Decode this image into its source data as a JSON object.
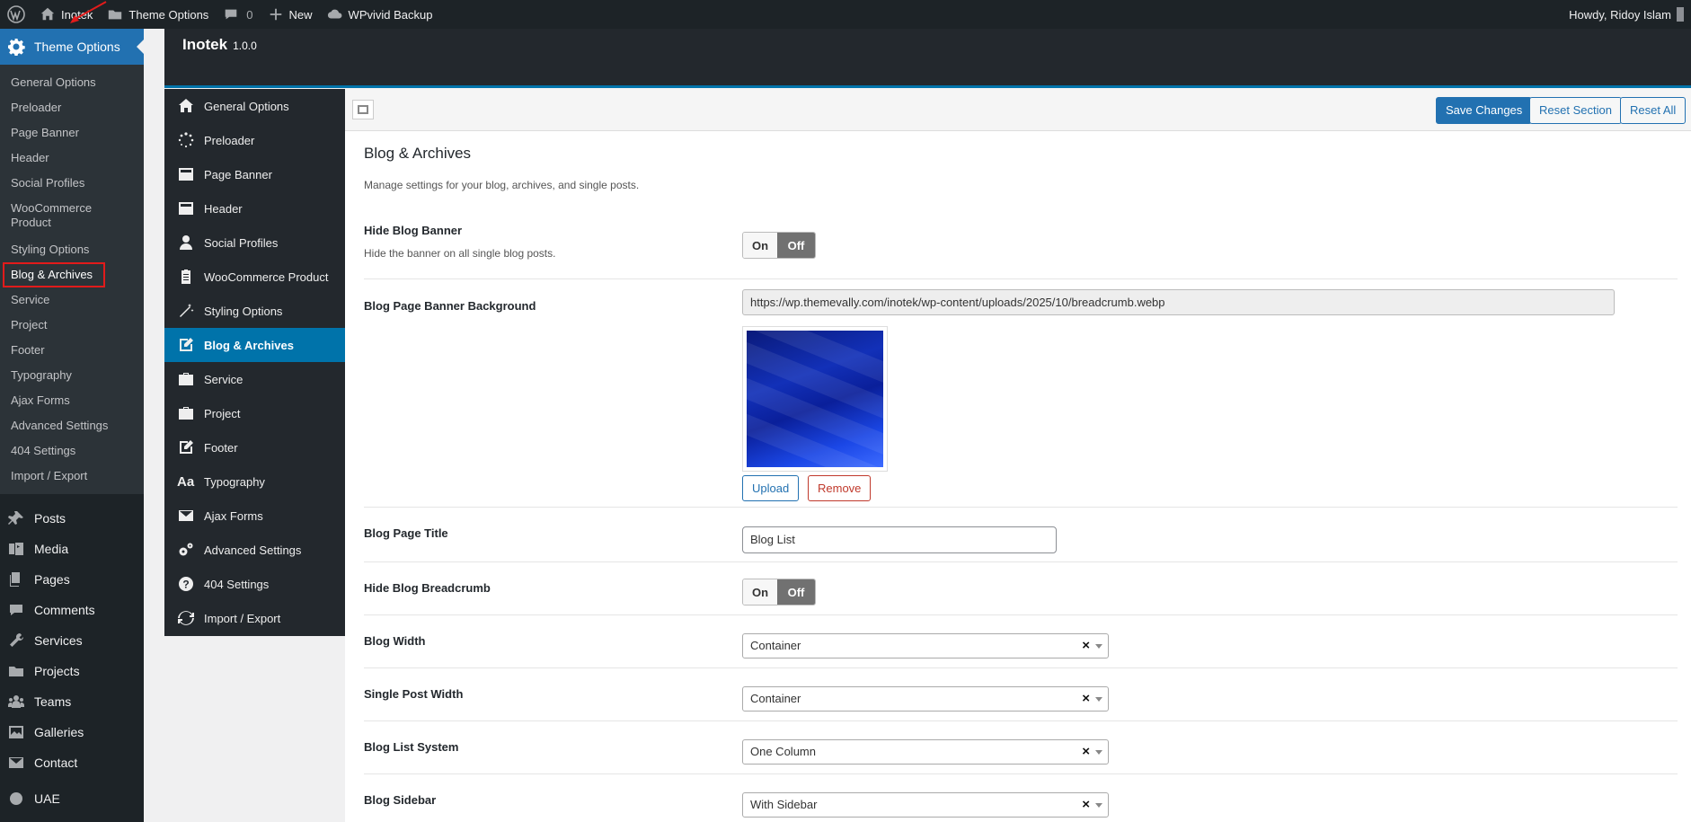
{
  "adminbar": {
    "site_name": "Inotek",
    "theme_options": "Theme Options",
    "comments_count": "0",
    "new_label": "New",
    "backup_label": "WPvivid Backup",
    "howdy": "Howdy, Ridoy Islam"
  },
  "wpmenu": {
    "current": "Theme Options",
    "submenu": [
      "General Options",
      "Preloader",
      "Page Banner",
      "Header",
      "Social Profiles",
      "WooCommerce Product",
      "Styling Options",
      "Blog & Archives",
      "Service",
      "Project",
      "Footer",
      "Typography",
      "Ajax Forms",
      "Advanced Settings",
      "404 Settings",
      "Import / Export"
    ],
    "top_items": [
      "Posts",
      "Media",
      "Pages",
      "Comments",
      "Services",
      "Projects",
      "Teams",
      "Galleries",
      "Contact",
      "UAE"
    ]
  },
  "panel": {
    "title": "Inotek",
    "version": "1.0.0"
  },
  "optnav": [
    "General Options",
    "Preloader",
    "Page Banner",
    "Header",
    "Social Profiles",
    "WooCommerce Product",
    "Styling Options",
    "Blog & Archives",
    "Service",
    "Project",
    "Footer",
    "Typography",
    "Ajax Forms",
    "Advanced Settings",
    "404 Settings",
    "Import / Export"
  ],
  "toolbar": {
    "save": "Save Changes",
    "reset_section": "Reset Section",
    "reset_all": "Reset All"
  },
  "section": {
    "title": "Blog & Archives",
    "desc": "Manage settings for your blog, archives, and single posts."
  },
  "fields": {
    "hide_banner_label": "Hide Blog Banner",
    "hide_banner_sub": "Hide the banner on all single blog posts.",
    "on": "On",
    "off": "Off",
    "banner_bg_label": "Blog Page Banner Background",
    "banner_bg_url": "https://wp.themevally.com/inotek/wp-content/uploads/2025/10/breadcrumb.webp",
    "upload": "Upload",
    "remove": "Remove",
    "page_title_label": "Blog Page Title",
    "page_title_value": "Blog List",
    "hide_breadcrumb_label": "Hide Blog Breadcrumb",
    "blog_width_label": "Blog Width",
    "blog_width_value": "Container",
    "single_width_label": "Single Post Width",
    "single_width_value": "Container",
    "list_system_label": "Blog List System",
    "list_system_value": "One Column",
    "sidebar_label": "Blog Sidebar",
    "sidebar_value": "With Sidebar",
    "clear": "×"
  }
}
